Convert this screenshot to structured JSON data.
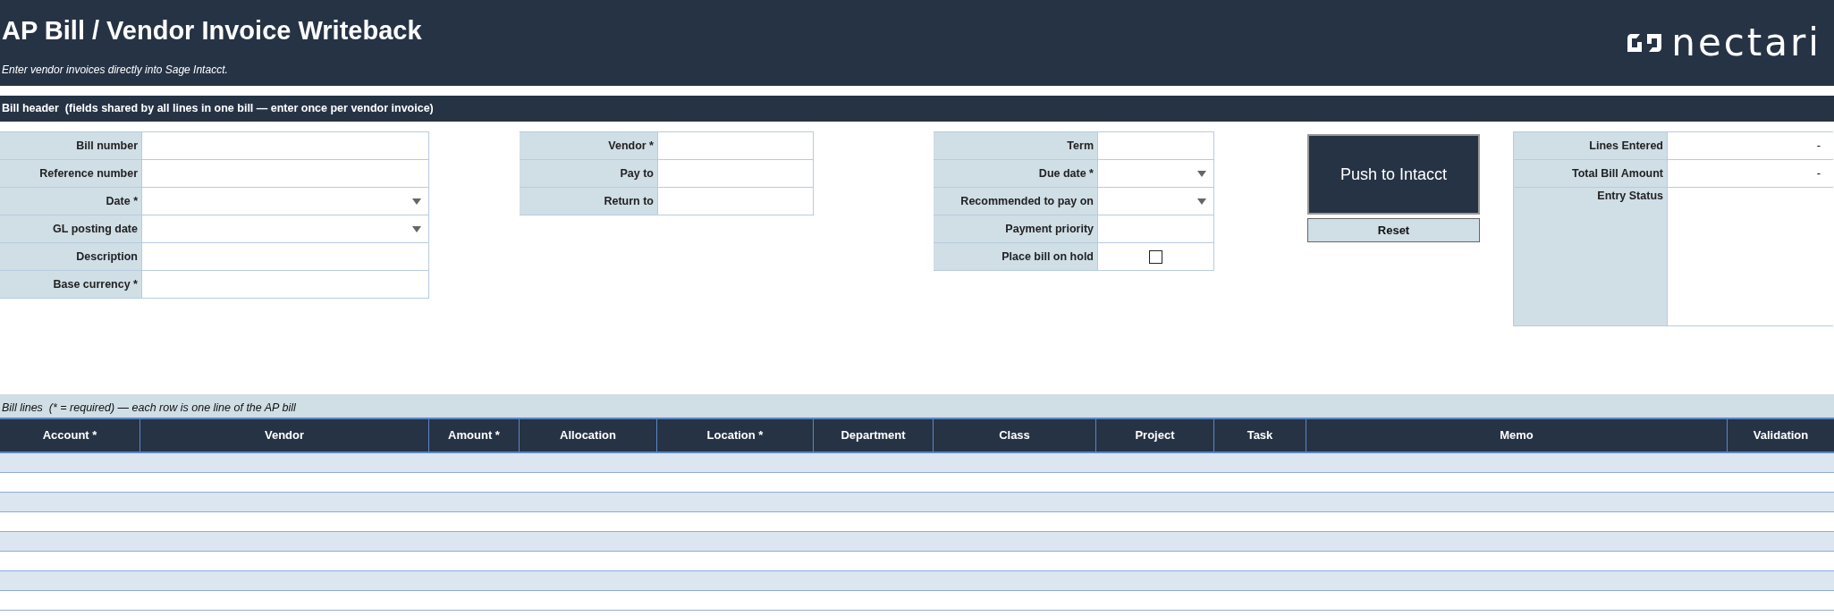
{
  "header": {
    "title": "AP Bill / Vendor Invoice Writeback",
    "subtitle": "Enter vendor invoices directly into Sage Intacct.",
    "logo": "nectari"
  },
  "bill_header": {
    "title": "Bill header  (fields shared by all lines in one bill — enter once per vendor invoice)",
    "groups": [
      {
        "fields": [
          {
            "label": "Bill number",
            "kind": "text"
          },
          {
            "label": "Reference number",
            "kind": "text"
          },
          {
            "label": "Date *",
            "kind": "dropdown"
          },
          {
            "label": "GL posting date",
            "kind": "dropdown"
          },
          {
            "label": "Description",
            "kind": "text"
          },
          {
            "label": "Base currency *",
            "kind": "text"
          }
        ]
      },
      {
        "fields": [
          {
            "label": "Vendor *",
            "kind": "text"
          },
          {
            "label": "Pay to",
            "kind": "text"
          },
          {
            "label": "Return to",
            "kind": "text"
          }
        ]
      },
      {
        "fields": [
          {
            "label": "Term",
            "kind": "text"
          },
          {
            "label": "Due date *",
            "kind": "dropdown"
          },
          {
            "label": "Recommended to pay on",
            "kind": "dropdown"
          },
          {
            "label": "Payment priority",
            "kind": "text"
          },
          {
            "label": "Place bill on hold",
            "kind": "checkbox",
            "checked": false
          }
        ]
      }
    ]
  },
  "buttons": [
    {
      "label": "Push to Intacct",
      "kind": "primary"
    },
    {
      "label": "Reset",
      "kind": "secondary"
    }
  ],
  "summary": [
    {
      "label": "Lines Entered",
      "value": "-"
    },
    {
      "label": "Total Bill Amount",
      "value": "-"
    },
    {
      "label": "Entry Status"
    }
  ],
  "bill_lines": {
    "title": "Bill lines  (* = required) — each row is one line of the AP bill",
    "columns": [
      "Account *",
      "Vendor",
      "Amount *",
      "Allocation",
      "Location *",
      "Department",
      "Class",
      "Project",
      "Task",
      "Memo",
      "Validation"
    ]
  }
}
